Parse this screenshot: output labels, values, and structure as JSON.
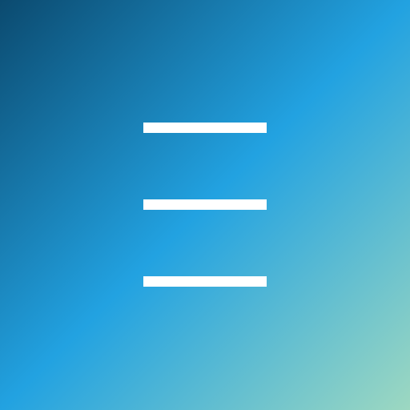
{
  "icon": {
    "name": "menu-icon"
  },
  "colors": {
    "gradient_start": "#0b4a6f",
    "gradient_mid": "#22a2e1",
    "gradient_end": "#9dd8c1",
    "bar": "#ffffff"
  }
}
